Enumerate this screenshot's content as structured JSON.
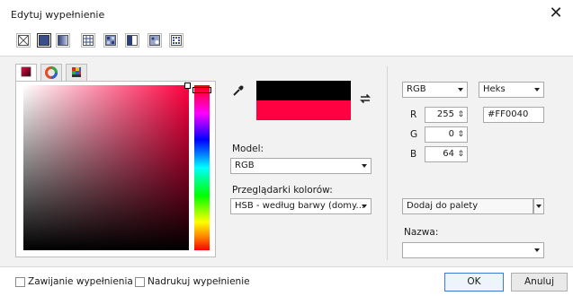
{
  "window": {
    "title": "Edytuj wypełnienie",
    "close_glyph": "✕"
  },
  "toolbar": {
    "buttons": [
      "no-fill-icon",
      "uniform-fill-icon",
      "fountain-fill-icon",
      "vector-pattern-icon",
      "bitmap-pattern-icon",
      "two-color-pattern-icon",
      "texture-fill-icon",
      "postscript-fill-icon"
    ]
  },
  "color_model_tabs": [
    "color-viewers-icon",
    "color-wheel-icon",
    "palette-icon"
  ],
  "preview": {
    "old_color": "#000000",
    "new_color": "#FF0040"
  },
  "model": {
    "label": "Model:",
    "value": "RGB"
  },
  "viewers": {
    "label": "Przeglądarki kolorów:",
    "value": "HSB - według barwy (domy..."
  },
  "values_mode": {
    "model": "RGB",
    "format": "Heks"
  },
  "channels": [
    {
      "label": "R",
      "value": "255"
    },
    {
      "label": "G",
      "value": "0"
    },
    {
      "label": "B",
      "value": "64"
    }
  ],
  "hex_value": "#FF0040",
  "palette": {
    "add_label": "Dodaj do palety"
  },
  "name": {
    "label": "Nazwa:",
    "value": ""
  },
  "footer": {
    "wrap_fill": "Zawijanie wypełnienia",
    "overprint_fill": "Nadrukuj wypełnienie",
    "ok": "OK",
    "cancel": "Anuluj"
  }
}
